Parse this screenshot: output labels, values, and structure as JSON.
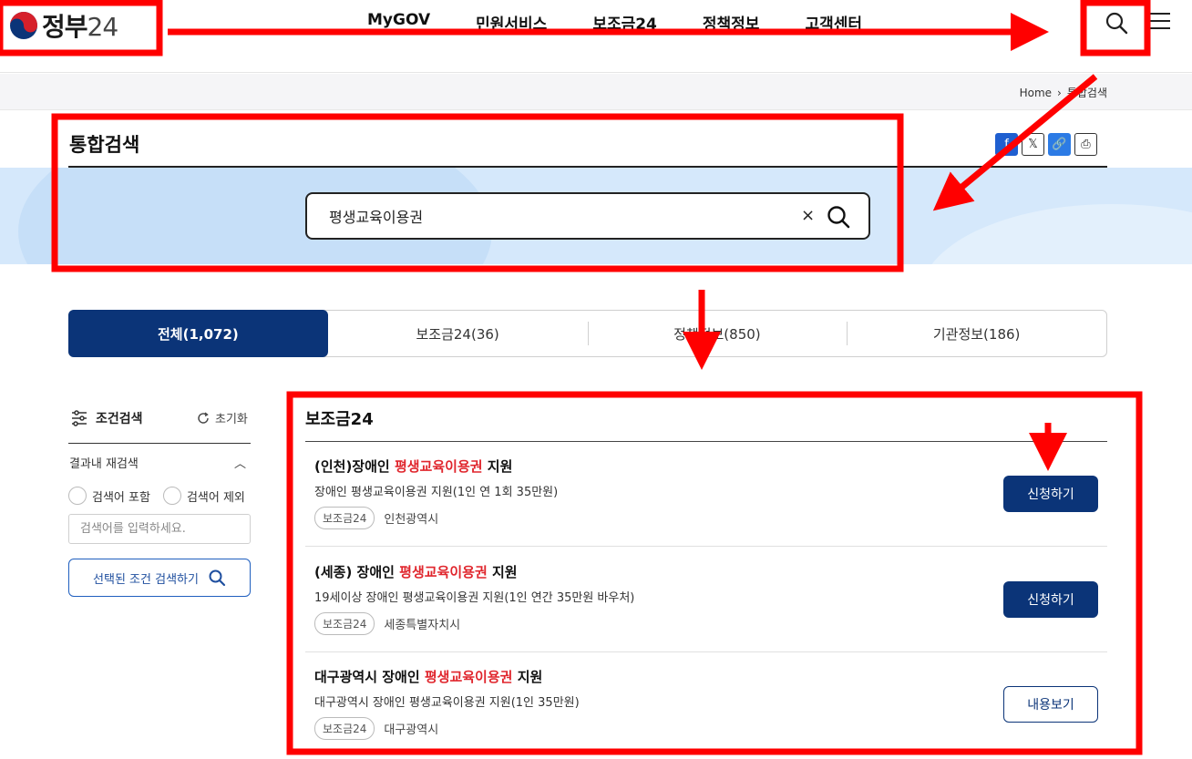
{
  "header": {
    "logo_text": "정부",
    "logo_num": "24",
    "nav": [
      "MyGOV",
      "민원서비스",
      "보조금24",
      "정책정보",
      "고객센터"
    ]
  },
  "breadcrumb": {
    "home": "Home",
    "current": "통합검색"
  },
  "page_title": "통합검색",
  "search": {
    "value": "평생교육이용권",
    "clear": "×"
  },
  "tabs": [
    "전체(1,072)",
    "보조금24(36)",
    "정책정보(850)",
    "기관정보(186)"
  ],
  "filter": {
    "title": "조건검색",
    "reset": "초기화",
    "re_search": "결과내 재검색",
    "include": "검색어 포함",
    "exclude": "검색어 제외",
    "placeholder": "검색어를 입력하세요.",
    "submit": "선택된 조건 검색하기"
  },
  "results": {
    "section_title": "보조금24",
    "items": [
      {
        "title_pre": "(인천)장애인 ",
        "title_hl": "평생교육이용권",
        "title_post": " 지원",
        "desc": "장애인 평생교육이용권 지원(1인 연 1회 35만원)",
        "tag": "보조금24",
        "org": "인천광역시",
        "button": "신청하기"
      },
      {
        "title_pre": "(세종) 장애인 ",
        "title_hl": "평생교육이용권",
        "title_post": " 지원",
        "desc": "19세이상 장애인 평생교육이용권 지원(1인 연간 35만원 바우처)",
        "tag": "보조금24",
        "org": "세종특별자치시",
        "button": "신청하기"
      },
      {
        "title_pre": "대구광역시 장애인 ",
        "title_hl": "평생교육이용권",
        "title_post": " 지원",
        "desc": "대구광역시 장애인 평생교육이용권 지원(1인 35만원)",
        "tag": "보조금24",
        "org": "대구광역시",
        "button": "내용보기"
      }
    ]
  },
  "colors": {
    "primary": "#0b3478",
    "highlight": "#e0262d",
    "annotation": "#ff0000",
    "band": "#d5e8fb"
  }
}
